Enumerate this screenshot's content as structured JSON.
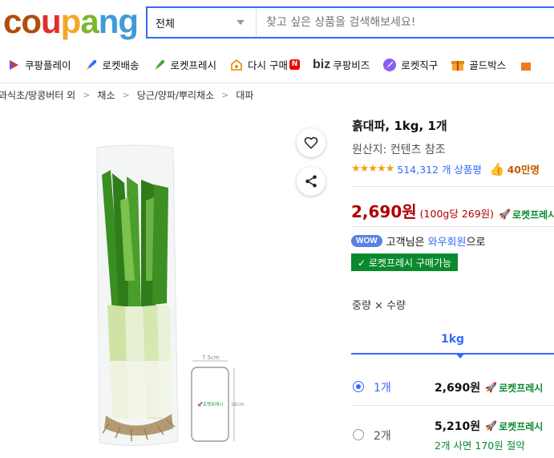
{
  "header": {
    "logo_letters": [
      "c",
      "o",
      "u",
      "p",
      "a",
      "n",
      "g"
    ],
    "logo_colors": [
      "#b04e0f",
      "#b04e0f",
      "#e0302b",
      "#f2a825",
      "#7bb72c",
      "#3f9bd6",
      "#3f9bd6"
    ],
    "category_select": "전체",
    "search_placeholder": "찾고 싶은 상품을 검색해보세요!"
  },
  "nav": {
    "items": [
      {
        "label": "쿠팡플레이",
        "icon": "play-icon"
      },
      {
        "label": "로켓배송",
        "icon": "rocket-icon"
      },
      {
        "label": "로켓프레시",
        "icon": "rocket-fresh-icon"
      },
      {
        "label": "다시 구매",
        "icon": "reorder-icon",
        "badge": "N"
      },
      {
        "label": "쿠팡비즈",
        "icon": "biz-logo",
        "prefix": "biz"
      },
      {
        "label": "로켓직구",
        "icon": "global-rocket-icon"
      },
      {
        "label": "골드박스",
        "icon": "goldbox-icon"
      }
    ]
  },
  "breadcrumb": [
    "과식초/땅콩버터 외",
    "채소",
    "당근/양파/뿌리채소",
    "대파"
  ],
  "product": {
    "title": "흙대파, 1kg, 1개",
    "origin": "원산지: 컨텐츠 참조",
    "stars": "★★★★★",
    "rating": 4.5,
    "reviews": "514,312 개 상품평",
    "buyers": "40만명",
    "price": "2,690원",
    "unit_price": "(100g당 269원)",
    "rocket_fresh": "로켓프레시",
    "wow_badge": "WOW",
    "wow_text_1": "고객님은",
    "wow_link": "와우회원",
    "wow_text_2": "으로",
    "fresh_available": "✓ 로켓프레시 구매가능",
    "option_label": "중량 × 수량",
    "weight_tab": "1kg",
    "options": [
      {
        "qty": "1개",
        "price": "2,690원",
        "selected": true,
        "saving": ""
      },
      {
        "qty": "2개",
        "price": "5,210원",
        "selected": false,
        "saving": "2개 사면 170원 절약"
      }
    ],
    "image_dims": {
      "width": "7.5cm",
      "height": "16cm"
    },
    "phone_badge": "로켓프레시"
  },
  "colors": {
    "accent": "#346aff",
    "price": "#ae0000",
    "fresh_green": "#0a8a2e"
  }
}
